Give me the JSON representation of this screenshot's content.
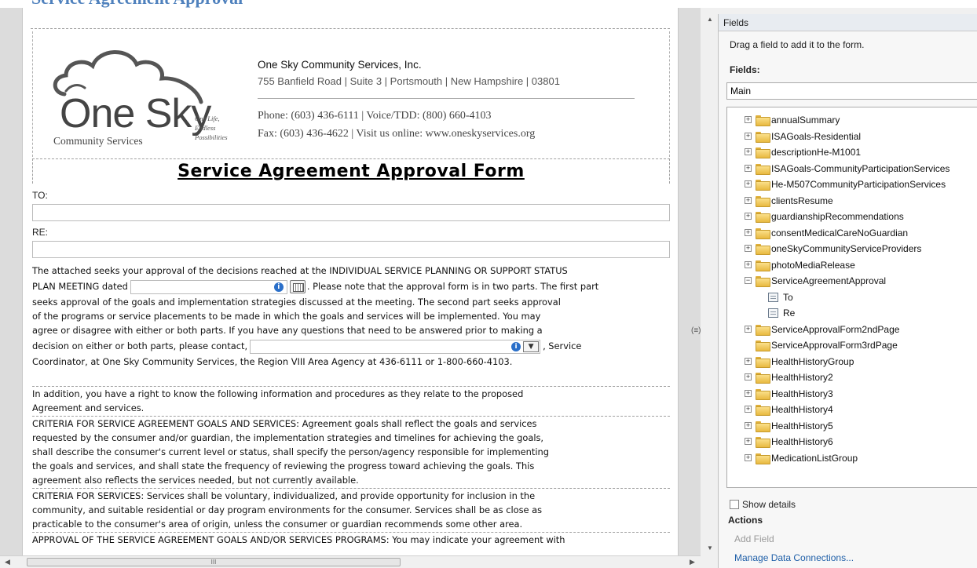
{
  "partial_heading": "Service Agreement Approval",
  "header": {
    "logo_name": "One Sky",
    "logo_sub": "Community Services",
    "logo_tagline": [
      "One Life,",
      "Endless",
      "Possibilities"
    ],
    "company": "One Sky Community Services, Inc.",
    "address": "755 Banfield Road | Suite 3 | Portsmouth | New Hampshire | 03801",
    "phone": "Phone: (603) 436-6111 | Voice/TDD: (800) 660-4103",
    "fax": "Fax: (603) 436-4622 | Visit us online: www.oneskyservices.org"
  },
  "form": {
    "title": "Service Agreement Approval Form",
    "to_label": "TO:",
    "re_label": "RE:",
    "para1": {
      "l1": "The attached seeks your approval of the decisions reached at the INDIVIDUAL SERVICE PLANNING OR SUPPORT STATUS",
      "l2_pre": "PLAN MEETING dated",
      "l2_post": ". Please note that the approval form is in two parts. The first part",
      "l3": "seeks approval of the goals and implementation strategies discussed at the meeting. The second part seeks approval",
      "l4": "of the programs or service placements to be made in which the goals and services will be implemented. You may",
      "l5": "agree or disagree with either or both parts. If you have any questions that need to be answered prior to making a",
      "l6_pre": "decision on either or both parts, please contact,",
      "l6_post": ", Service",
      "l7": "Coordinator, at One Sky Community Services, the Region VIII Area Agency at 436-6111 or 1-800-660-4103."
    },
    "para2": [
      "In addition, you have a right to know the following information and procedures as they relate to the proposed",
      "Agreement and services."
    ],
    "para3": [
      "CRITERIA FOR SERVICE AGREEMENT GOALS AND SERVICES: Agreement goals shall reflect the goals and services",
      "requested by the consumer and/or guardian, the implementation strategies and timelines for achieving the goals,",
      "shall describe the consumer's current level or status, shall specify the person/agency responsible for implementing",
      "the goals and services, and shall state the frequency of reviewing the progress toward achieving the goals. This",
      "agreement also reflects the services needed, but not currently available."
    ],
    "para4": [
      "CRITERIA FOR SERVICES: Services shall be voluntary, individualized, and provide opportunity for inclusion in the",
      "community, and suitable residential or day program environments for the consumer. Services shall be as close as",
      "practicable to the consumer's area of origin, unless the consumer or guardian recommends some other area."
    ],
    "para5": "APPROVAL OF THE SERVICE AGREEMENT GOALS AND/OR SERVICES PROGRAMS: You may indicate your agreement with"
  },
  "fields_pane": {
    "header": "Fields",
    "hint": "Drag a field to add it to the form.",
    "fields_label": "Fields:",
    "datasource": "Main",
    "nodes": [
      {
        "label": "annualSummary",
        "type": "group",
        "state": "collapsed"
      },
      {
        "label": "ISAGoals-Residential",
        "type": "group",
        "state": "collapsed"
      },
      {
        "label": "descriptionHe-M1001",
        "type": "group",
        "state": "collapsed"
      },
      {
        "label": "ISAGoals-CommunityParticipationServices",
        "type": "group",
        "state": "collapsed"
      },
      {
        "label": "He-M507CommunityParticipationServices",
        "type": "group",
        "state": "collapsed"
      },
      {
        "label": "clientsResume",
        "type": "group",
        "state": "collapsed"
      },
      {
        "label": "guardianshipRecommendations",
        "type": "group",
        "state": "collapsed"
      },
      {
        "label": "consentMedicalCareNoGuardian",
        "type": "group",
        "state": "collapsed"
      },
      {
        "label": "oneSkyCommunityServiceProviders",
        "type": "group",
        "state": "collapsed"
      },
      {
        "label": "photoMediaRelease",
        "type": "group",
        "state": "collapsed"
      },
      {
        "label": "ServiceAgreementApproval",
        "type": "group",
        "state": "expanded"
      },
      {
        "label": "To",
        "type": "field",
        "state": "leaf"
      },
      {
        "label": "Re",
        "type": "field",
        "state": "leaf"
      },
      {
        "label": "ServiceApprovalForm2ndPage",
        "type": "group",
        "state": "collapsed"
      },
      {
        "label": "ServiceApprovalForm3rdPage",
        "type": "group",
        "state": "none"
      },
      {
        "label": "HealthHistoryGroup",
        "type": "group",
        "state": "collapsed"
      },
      {
        "label": "HealthHistory2",
        "type": "group",
        "state": "collapsed"
      },
      {
        "label": "HealthHistory3",
        "type": "group",
        "state": "collapsed"
      },
      {
        "label": "HealthHistory4",
        "type": "group",
        "state": "collapsed"
      },
      {
        "label": "HealthHistory5",
        "type": "group",
        "state": "collapsed"
      },
      {
        "label": "HealthHistory6",
        "type": "group",
        "state": "collapsed"
      },
      {
        "label": "MedicationListGroup",
        "type": "group",
        "state": "collapsed"
      }
    ],
    "show_details": "Show details",
    "actions_label": "Actions",
    "add_field": "Add Field",
    "manage_connections": "Manage Data Connections..."
  },
  "colors": {
    "heading_blue": "#4f81bd",
    "folder": "#f0c24e",
    "link": "#1f5fa8",
    "info_icon": "#2a6fc9"
  },
  "icons": [
    "folder-icon",
    "field-icon",
    "expand-icon",
    "collapse-icon",
    "info-icon",
    "calendar-icon",
    "dropdown-icon",
    "cloud-logo"
  ]
}
